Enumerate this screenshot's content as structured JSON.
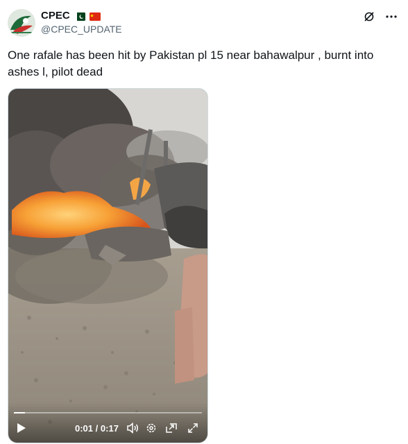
{
  "post": {
    "display_name": "CPEC",
    "handle": "@CPEC_UPDATE",
    "text": "One rafale has been hit by Pakistan pl 15 near bahawalpur , burnt into ashes l, pilot dead"
  },
  "flags": [
    "pakistan-flag-icon",
    "china-flag-icon"
  ],
  "header_icons": [
    "grok-icon",
    "more-icon"
  ],
  "video": {
    "time_current": "0:01",
    "time_separator": "/",
    "time_total": "0:17",
    "progress": 0.06,
    "controls": [
      "play-icon",
      "volume-icon",
      "settings-icon",
      "picture-in-picture-icon",
      "fullscreen-icon"
    ]
  }
}
